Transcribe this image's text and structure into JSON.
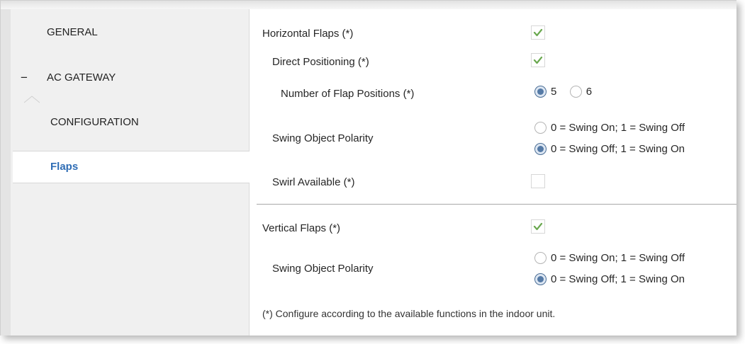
{
  "sidebar": {
    "items": [
      {
        "label": "GENERAL"
      },
      {
        "label": "AC GATEWAY",
        "expander": "−"
      },
      {
        "label": "CONFIGURATION"
      },
      {
        "label": "Flaps",
        "selected": true
      }
    ]
  },
  "params": {
    "horizontal_flaps": {
      "label": "Horizontal Flaps (*)",
      "checked": true
    },
    "direct_positioning": {
      "label": "Direct Positioning (*)",
      "checked": true
    },
    "num_flap_positions": {
      "label": "Number of Flap Positions (*)",
      "options": [
        "5",
        "6"
      ],
      "selected": "5"
    },
    "h_swing_polarity": {
      "label": "Swing Object Polarity",
      "options": [
        "0 = Swing On; 1 = Swing Off",
        "0 = Swing Off; 1 = Swing On"
      ],
      "selected": "0 = Swing Off; 1 = Swing On"
    },
    "swirl_available": {
      "label": "Swirl Available (*)",
      "checked": false
    },
    "vertical_flaps": {
      "label": "Vertical Flaps (*)",
      "checked": true
    },
    "v_swing_polarity": {
      "label": "Swing Object Polarity",
      "options": [
        "0 = Swing On; 1 = Swing Off",
        "0 = Swing Off; 1 = Swing On"
      ],
      "selected": "0 = Swing Off; 1 = Swing On"
    }
  },
  "footnote": "(*) Configure according to the available functions in the indoor unit.",
  "colors": {
    "accent": "#2f6db5",
    "check": "#6aa84f",
    "sidebar_bg": "#f0f0f0",
    "radio_selected": "#557aa6"
  }
}
